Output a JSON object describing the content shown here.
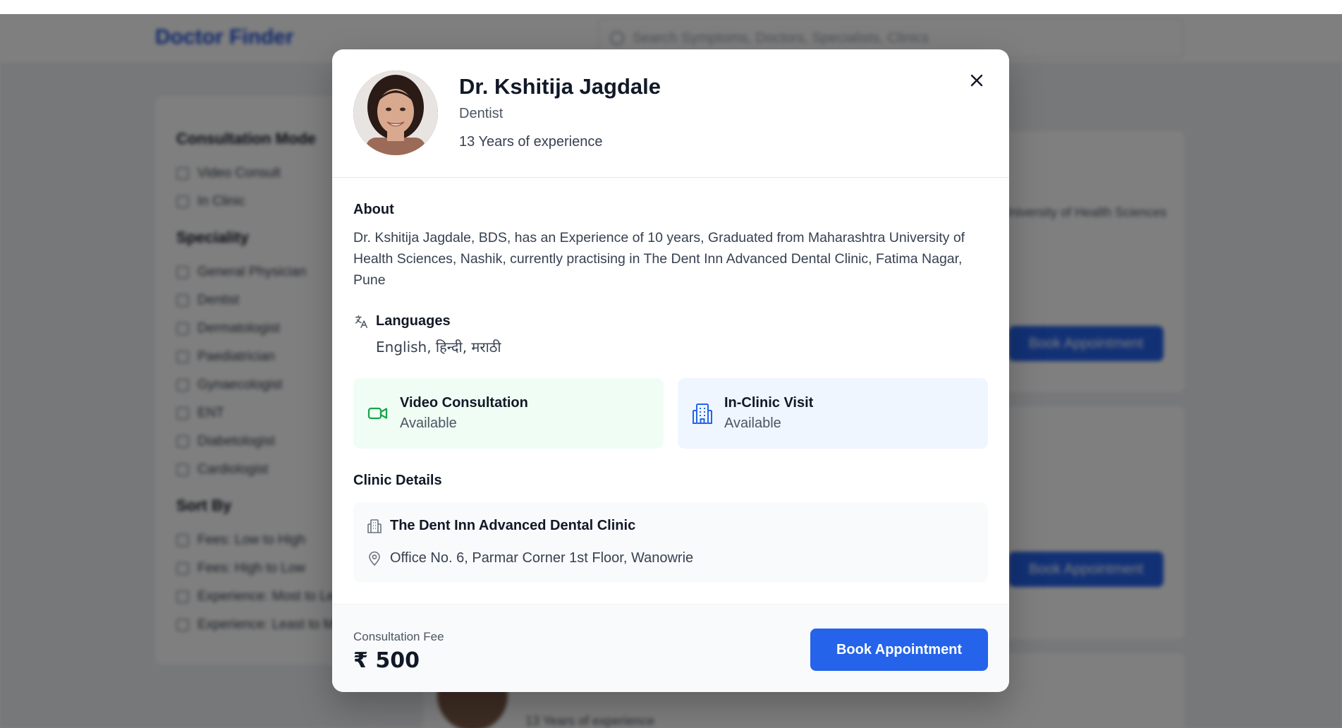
{
  "background": {
    "app_title": "Doctor Finder",
    "search_placeholder": "Search Symptoms, Doctors, Specialists, Clinics",
    "filters": {
      "consultation_mode_title": "Consultation Mode",
      "consultation_modes": [
        "Video Consult",
        "In Clinic"
      ],
      "specialty_title": "Speciality",
      "specialties": [
        "General Physician",
        "Dentist",
        "Dermatologist",
        "Paediatrician",
        "Gynaecologist",
        "ENT",
        "Diabetologist",
        "Cardiologist"
      ],
      "sort_title": "Sort By",
      "sort_options": [
        "Fees: Low to High",
        "Fees: High to Low",
        "Experience: Most to Least",
        "Experience: Least to Most"
      ]
    },
    "card_texts": {
      "university_snippet": "University of Health Sciences",
      "book_button": "Book Appointment",
      "experience_snippet": "13 Years of experience"
    }
  },
  "modal": {
    "doctor_name": "Dr. Kshitija Jagdale",
    "specialty": "Dentist",
    "experience": "13 Years of experience",
    "about_title": "About",
    "about_text": "Dr. Kshitija Jagdale, BDS, has an Experience of 10 years, Graduated from Maharashtra University of Health Sciences, Nashik, currently practising in The Dent Inn Advanced Dental Clinic, Fatima Nagar, Pune",
    "languages_title": "Languages",
    "languages": "English, हिन्दी, मराठी",
    "video": {
      "title": "Video Consultation",
      "status": "Available",
      "icon": "video-camera-icon"
    },
    "clinic_visit": {
      "title": "In-Clinic Visit",
      "status": "Available",
      "icon": "hospital-building-icon"
    },
    "clinic_details_title": "Clinic Details",
    "clinic_name": "The Dent Inn Advanced Dental Clinic",
    "clinic_address": "Office No. 6, Parmar Corner 1st Floor, Wanowrie",
    "fee_label": "Consultation Fee",
    "fee_value": "₹ 500",
    "book_button": "Book Appointment",
    "colors": {
      "primary": "#2563eb",
      "video_bg": "#f0fdf4",
      "video_icon": "#16a34a",
      "clinic_bg": "#eff6ff",
      "clinic_icon": "#2563eb"
    }
  }
}
